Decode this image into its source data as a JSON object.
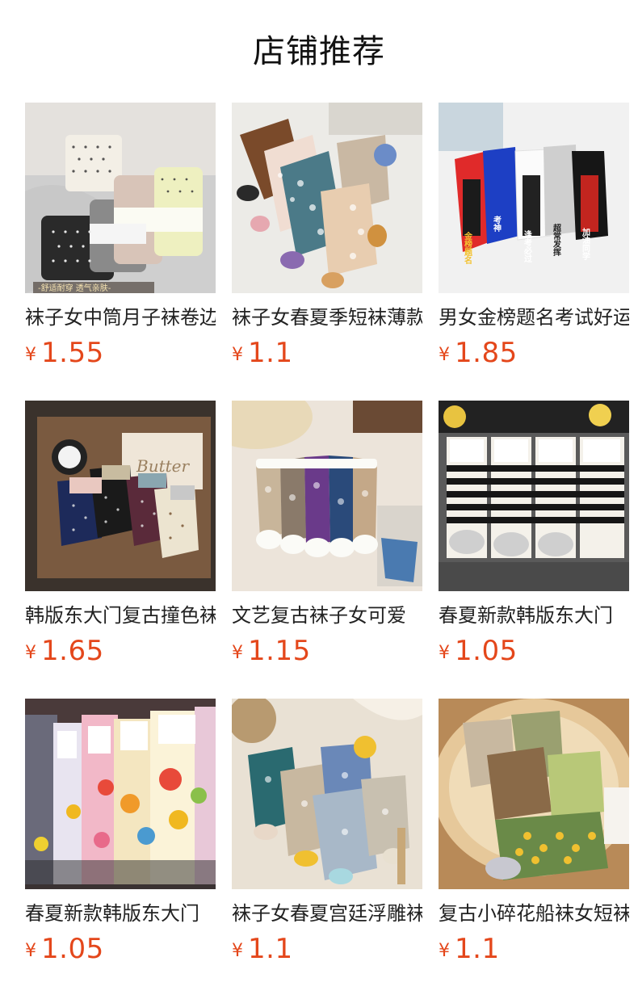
{
  "section": {
    "title": "店铺推荐"
  },
  "colors": {
    "price": "#e4471b",
    "text": "#222222"
  },
  "products": [
    {
      "name": "袜子女中筒月子袜卷边",
      "currency": "¥",
      "price": "1.55",
      "image_caption": "-舒适耐穿 透气亲肤-"
    },
    {
      "name": "袜子女春夏季短袜薄款",
      "currency": "¥",
      "price": "1.1"
    },
    {
      "name": "男女金榜题名考试好运",
      "currency": "¥",
      "price": "1.85",
      "image_labels": [
        "金榜题名",
        "考神",
        "逢考必过",
        "超常发挥",
        "加油同学"
      ]
    },
    {
      "name": "韩版东大门复古撞色袜",
      "currency": "¥",
      "price": "1.65",
      "image_labels": [
        "Butter"
      ]
    },
    {
      "name": "文艺复古袜子女可爱",
      "currency": "¥",
      "price": "1.15"
    },
    {
      "name": "春夏新款韩版东大门",
      "currency": "¥",
      "price": "1.05"
    },
    {
      "name": "春夏新款韩版东大门",
      "currency": "¥",
      "price": "1.05"
    },
    {
      "name": "袜子女春夏宫廷浮雕袜",
      "currency": "¥",
      "price": "1.1"
    },
    {
      "name": "复古小碎花船袜女短袜",
      "currency": "¥",
      "price": "1.1"
    }
  ]
}
